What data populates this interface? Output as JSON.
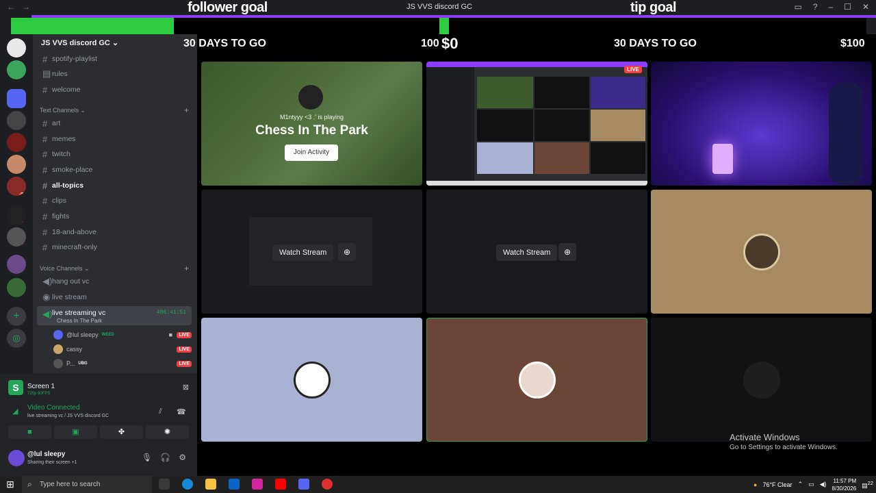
{
  "titlebar": {
    "title": "JS VVS discord GC",
    "back": "←",
    "forward": "→"
  },
  "overlay": {
    "follower_label": "follower goal",
    "tip_label": "tip goal",
    "left_days": "30 DAYS TO GO",
    "left_count": "100",
    "left_amount": "$0",
    "right_days": "30 DAYS TO GO",
    "right_amount": "$100",
    "follower_progress": 0.19
  },
  "server": {
    "name": "JS VVS discord GC ⌄"
  },
  "channels": {
    "top": [
      "spotify-playlist",
      "rules",
      "welcome"
    ],
    "text_category": "Text Channels ⌄",
    "text": [
      "art",
      "memes",
      "twitch",
      "smoke-place",
      "all-topics",
      "clips",
      "fights",
      "18-and-above",
      "minecraft-only"
    ],
    "voice_category": "Voice Channels ⌄",
    "voice": [
      "hang out vc",
      "live stream"
    ],
    "selected_vc": "live streaming vc",
    "selected_vc_sub": "Chess In The Park",
    "timer": "486:41:51",
    "members": [
      {
        "name": "@lul sleepy",
        "tag": "WEED"
      },
      {
        "name": "cassy",
        "tag": ""
      },
      {
        "name": "P...",
        "tag": "UBG"
      }
    ],
    "live_label": "LIVE"
  },
  "panel": {
    "screen_title": "Screen 1",
    "screen_sub": "720p 60FPS",
    "connected": "Video Connected",
    "connected_sub": "live streaming vc / JS VVS discord GC",
    "username": "@lul sleepy",
    "status": "Sharing their screen +1"
  },
  "tiles": {
    "activity_player": "M1ntyyy <3 .' is playing",
    "activity_title": "Chess In The Park",
    "join": "Join Activity",
    "watch": "Watch Stream",
    "live": "LIVE"
  },
  "watermark": {
    "title": "Activate Windows",
    "sub": "Go to Settings to activate Windows."
  },
  "taskbar": {
    "search": "Type here to search",
    "weather": "76°F  Clear",
    "time": "11:57 PM",
    "date": "8/30/2026",
    "notif": "22"
  }
}
